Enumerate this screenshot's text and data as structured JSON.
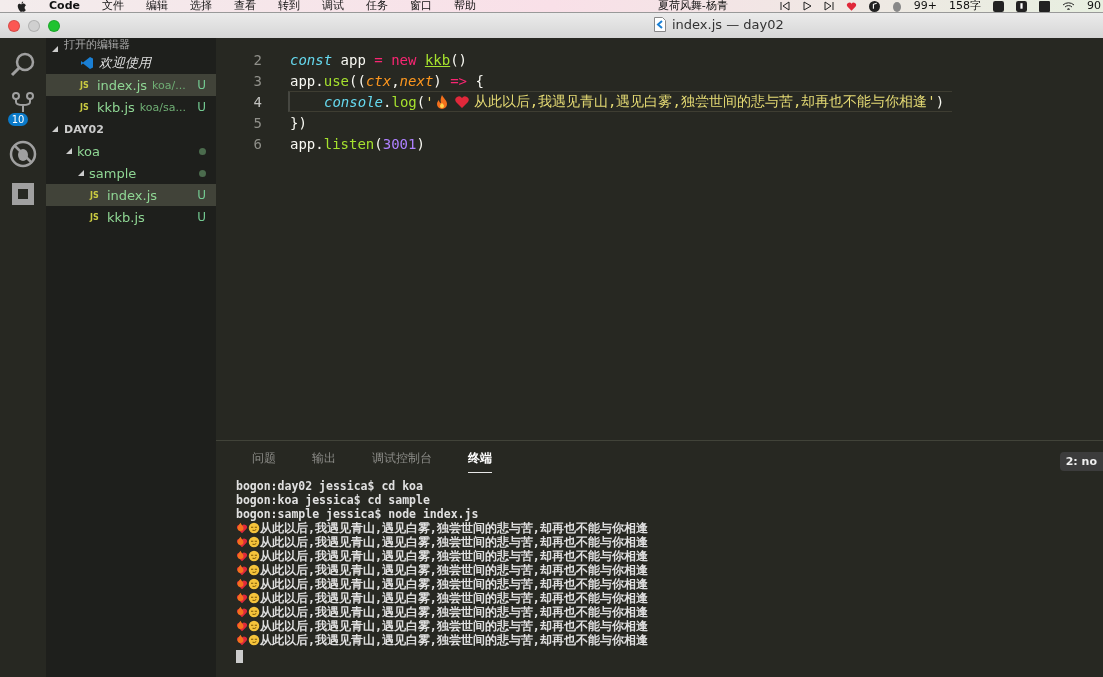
{
  "menubar": {
    "app": "Code",
    "menus": [
      "文件",
      "编辑",
      "选择",
      "查看",
      "转到",
      "调试",
      "任务",
      "窗口",
      "帮助"
    ],
    "song": "夏荷风舞-杨青",
    "qq_badge": "99+",
    "word_count": "158字",
    "battery": "90"
  },
  "window": {
    "title": "index.js — day02"
  },
  "activity_bar": {
    "scm_badge": "10"
  },
  "sidebar": {
    "open_editors_title": "打开的编辑器",
    "open_editors": [
      {
        "kind": "welcome",
        "name": "欢迎使用",
        "selected": false
      },
      {
        "kind": "js",
        "badge": "JS",
        "name": "index.js",
        "path": "koa/...",
        "status": "U",
        "selected": true
      },
      {
        "kind": "js",
        "badge": "JS",
        "name": "kkb.js",
        "path": "koa/sa...",
        "status": "U",
        "selected": false
      }
    ],
    "folder": "DAY02",
    "tree": [
      {
        "kind": "folder",
        "name": "koa",
        "expanded": true,
        "selected": false,
        "children": [
          {
            "kind": "folder",
            "name": "sample",
            "expanded": true,
            "selected": false,
            "children": [
              {
                "kind": "js",
                "badge": "JS",
                "name": "index.js",
                "status": "U",
                "selected": true
              },
              {
                "kind": "js",
                "badge": "JS",
                "name": "kkb.js",
                "status": "U",
                "selected": false
              }
            ]
          }
        ]
      }
    ]
  },
  "editor": {
    "lines": [
      {
        "number": "2",
        "active": false,
        "tokens": [
          {
            "kind": "keyword",
            "text": "const"
          },
          {
            "kind": "plain",
            "text": " app "
          },
          {
            "kind": "operator",
            "text": "= new "
          },
          {
            "kind": "class",
            "text": "kkb"
          },
          {
            "kind": "plain",
            "text": "()"
          }
        ]
      },
      {
        "number": "3",
        "active": false,
        "tokens": [
          {
            "kind": "plain",
            "text": "app."
          },
          {
            "kind": "func",
            "text": "use"
          },
          {
            "kind": "plain",
            "text": "(("
          },
          {
            "kind": "param",
            "text": "ctx"
          },
          {
            "kind": "plain",
            "text": ","
          },
          {
            "kind": "param",
            "text": "next"
          },
          {
            "kind": "plain",
            "text": ") "
          },
          {
            "kind": "operator",
            "text": "=> "
          },
          {
            "kind": "plain",
            "text": "{"
          }
        ]
      },
      {
        "number": "4",
        "active": true,
        "tokens": [
          {
            "kind": "indent"
          },
          {
            "kind": "keyword",
            "text": "console"
          },
          {
            "kind": "plain",
            "text": "."
          },
          {
            "kind": "func",
            "text": "log"
          },
          {
            "kind": "plain",
            "text": "("
          },
          {
            "kind": "string",
            "text": "'"
          },
          {
            "kind": "fire"
          },
          {
            "kind": "heart"
          },
          {
            "kind": "string",
            "text": "从此以后,我遇见青山,遇见白雾,独尝世间的悲与苦,却再也不能与你相逢'"
          },
          {
            "kind": "plain",
            "text": ")"
          }
        ]
      },
      {
        "number": "5",
        "active": false,
        "tokens": [
          {
            "kind": "plain",
            "text": "})"
          }
        ]
      },
      {
        "number": "6",
        "active": false,
        "tokens": [
          {
            "kind": "plain",
            "text": "app."
          },
          {
            "kind": "func",
            "text": "listen"
          },
          {
            "kind": "plain",
            "text": "("
          },
          {
            "kind": "number",
            "text": "3001"
          },
          {
            "kind": "plain",
            "text": ")"
          }
        ]
      }
    ]
  },
  "panel": {
    "tabs": [
      {
        "label": "问题",
        "selected": false
      },
      {
        "label": "输出",
        "selected": false
      },
      {
        "label": "调试控制台",
        "selected": false
      },
      {
        "label": "终端",
        "selected": true
      }
    ],
    "terminal_select": "2: no",
    "terminal": [
      {
        "kind": "command",
        "text": "bogon:day02 jessica$ cd koa"
      },
      {
        "kind": "command",
        "text": "bogon:koa jessica$ cd sample"
      },
      {
        "kind": "command",
        "text": "bogon:sample jessica$ node index.js"
      },
      {
        "kind": "output",
        "text": "从此以后,我遇见青山,遇见白雾,独尝世间的悲与苦,却再也不能与你相逢"
      },
      {
        "kind": "output",
        "text": "从此以后,我遇见青山,遇见白雾,独尝世间的悲与苦,却再也不能与你相逢"
      },
      {
        "kind": "output",
        "text": "从此以后,我遇见青山,遇见白雾,独尝世间的悲与苦,却再也不能与你相逢"
      },
      {
        "kind": "output",
        "text": "从此以后,我遇见青山,遇见白雾,独尝世间的悲与苦,却再也不能与你相逢"
      },
      {
        "kind": "output",
        "text": "从此以后,我遇见青山,遇见白雾,独尝世间的悲与苦,却再也不能与你相逢"
      },
      {
        "kind": "output",
        "text": "从此以后,我遇见青山,遇见白雾,独尝世间的悲与苦,却再也不能与你相逢"
      },
      {
        "kind": "output",
        "text": "从此以后,我遇见青山,遇见白雾,独尝世间的悲与苦,却再也不能与你相逢"
      },
      {
        "kind": "output",
        "text": "从此以后,我遇见青山,遇见白雾,独尝世间的悲与苦,却再也不能与你相逢"
      },
      {
        "kind": "output",
        "text": "从此以后,我遇见青山,遇见白雾,独尝世间的悲与苦,却再也不能与你相逢"
      }
    ]
  }
}
